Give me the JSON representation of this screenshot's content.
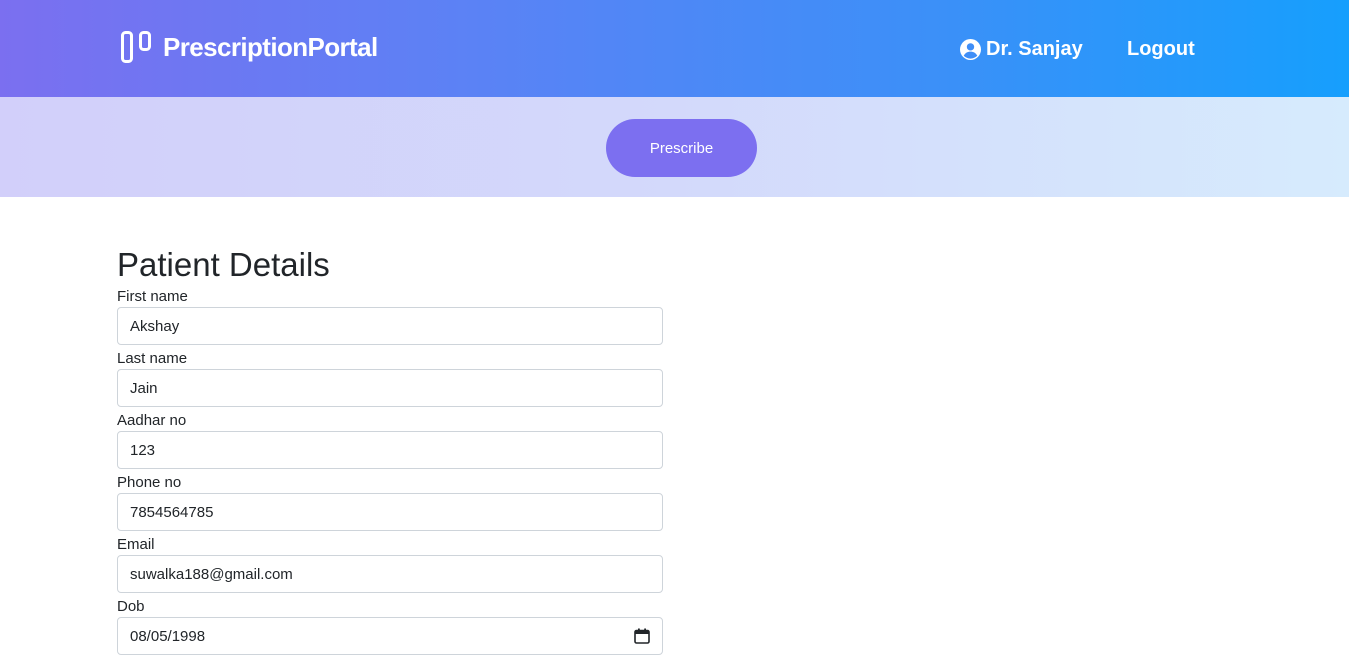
{
  "navbar": {
    "brand": "PrescriptionPortal",
    "brand_icon": "columns-logo-icon",
    "user": "Dr. Sanjay",
    "user_icon": "user-circle-icon",
    "logout": "Logout"
  },
  "actions": {
    "prescribe": "Prescribe"
  },
  "form": {
    "title": "Patient Details",
    "fields": [
      {
        "label": "First name",
        "value": "Akshay"
      },
      {
        "label": "Last name",
        "value": "Jain"
      },
      {
        "label": "Aadhar no",
        "value": "123"
      },
      {
        "label": "Phone no",
        "value": "7854564785"
      },
      {
        "label": "Email",
        "value": "suwalka188@gmail.com"
      },
      {
        "label": "Dob",
        "value": "08/05/1998"
      }
    ]
  },
  "colors": {
    "navbar_start": "#7b6ff0",
    "navbar_end": "#169ffd",
    "prescribe_button": "#7c6ff0"
  }
}
